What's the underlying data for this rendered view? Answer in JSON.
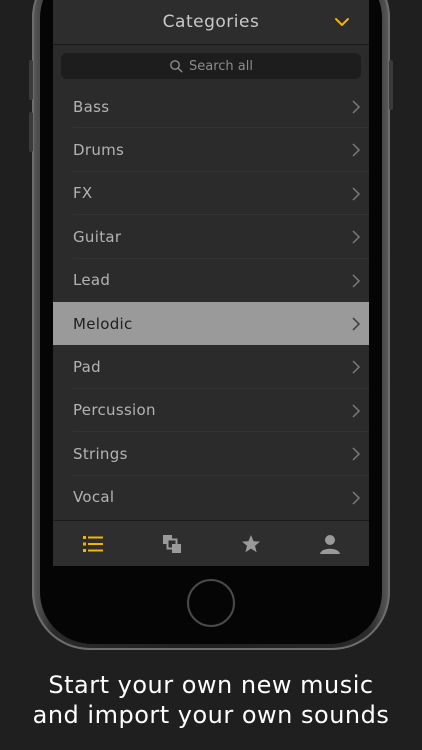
{
  "header": {
    "title": "Categories"
  },
  "search": {
    "placeholder": "Search all"
  },
  "categories": [
    {
      "label": "Bass"
    },
    {
      "label": "Drums"
    },
    {
      "label": "FX"
    },
    {
      "label": "Guitar"
    },
    {
      "label": "Lead"
    },
    {
      "label": "Melodic",
      "selected": true
    },
    {
      "label": "Pad"
    },
    {
      "label": "Percussion"
    },
    {
      "label": "Strings"
    },
    {
      "label": "Vocal"
    }
  ],
  "tabbar": {
    "tabs": [
      {
        "icon": "list-icon",
        "active": true
      },
      {
        "icon": "layers-icon"
      },
      {
        "icon": "star-icon"
      },
      {
        "icon": "user-icon"
      }
    ]
  },
  "caption": {
    "line1": "Start your own new music",
    "line2": "and import your own sounds"
  },
  "colors": {
    "accent": "#f5b400",
    "background": "#1f1f1f",
    "screen": "#2b2b2b",
    "selected_row": "#9a9a9a"
  }
}
